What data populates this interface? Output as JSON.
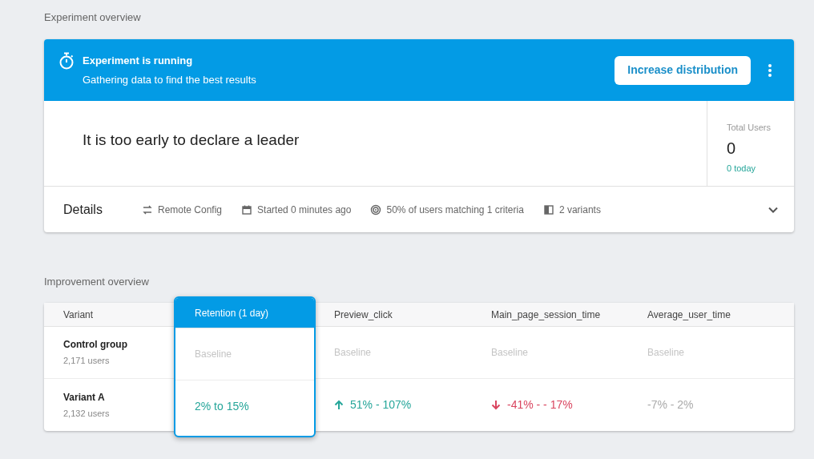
{
  "experiment_section": {
    "title": "Experiment overview"
  },
  "banner": {
    "title": "Experiment is running",
    "subtitle": "Gathering data to find the best results",
    "button": "Increase distribution"
  },
  "summary": {
    "headline": "It is too early to declare a leader",
    "total_users": {
      "label": "Total Users",
      "value": "0",
      "today": "0 today"
    }
  },
  "details": {
    "label": "Details",
    "expanded": false,
    "items": [
      {
        "kind": "config",
        "text": "Remote Config"
      },
      {
        "kind": "calendar",
        "text": "Started 0 minutes ago"
      },
      {
        "kind": "target",
        "text": "50% of users matching 1 criteria"
      },
      {
        "kind": "variants",
        "text": "2 variants"
      }
    ]
  },
  "improvement_section": {
    "title": "Improvement overview"
  },
  "table": {
    "columns": [
      {
        "label": "Variant",
        "selected": false
      },
      {
        "label": "Retention (1 day)",
        "selected": true
      },
      {
        "label": "Preview_click",
        "selected": false
      },
      {
        "label": "Main_page_session_time",
        "selected": false
      },
      {
        "label": "Average_user_time",
        "selected": false
      }
    ],
    "rows": [
      {
        "cells": [
          {
            "kind": "variant",
            "name": "Control group",
            "users": "2,171 users"
          },
          {
            "kind": "baseline",
            "text": "Baseline"
          },
          {
            "kind": "baseline",
            "text": "Baseline"
          },
          {
            "kind": "baseline",
            "text": "Baseline"
          },
          {
            "kind": "baseline",
            "text": "Baseline"
          }
        ]
      },
      {
        "cells": [
          {
            "kind": "variant",
            "name": "Variant A",
            "users": "2,132 users"
          },
          {
            "kind": "positive",
            "text": "2% to 15%"
          },
          {
            "kind": "positive",
            "increase": true,
            "text": "51% - 107%"
          },
          {
            "kind": "negative",
            "increase": false,
            "text": "-41% - - 17%"
          },
          {
            "kind": "neutral",
            "text": "-7% - 2%"
          }
        ]
      }
    ]
  }
}
